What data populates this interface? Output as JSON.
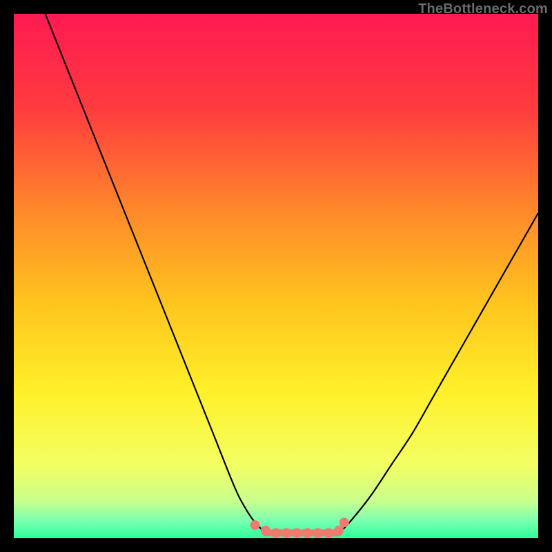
{
  "attribution": "TheBottleneck.com",
  "chart_data": {
    "type": "line",
    "title": "",
    "xlabel": "",
    "ylabel": "",
    "xlim": [
      0,
      100
    ],
    "ylim": [
      0,
      100
    ],
    "grid": false,
    "series": [
      {
        "name": "left-curve",
        "x": [
          6,
          10,
          14,
          18,
          22,
          26,
          30,
          34,
          38,
          42,
          44,
          46,
          48
        ],
        "y": [
          100,
          90,
          80,
          70,
          60,
          50,
          40,
          30,
          20,
          10,
          6,
          3,
          1
        ]
      },
      {
        "name": "right-curve",
        "x": [
          62,
          64,
          68,
          72,
          76,
          80,
          84,
          88,
          92,
          96,
          100
        ],
        "y": [
          1,
          3,
          8,
          14,
          20,
          27,
          34,
          41,
          48,
          55,
          62
        ]
      }
    ],
    "markers": {
      "name": "bottom-cluster",
      "x": [
        46,
        48,
        50,
        52,
        54,
        56,
        58,
        60,
        62,
        63
      ],
      "y": [
        2.5,
        1.5,
        1,
        1,
        1,
        1,
        1,
        1,
        1.5,
        3
      ]
    },
    "gradient_stops": [
      {
        "offset": 0.0,
        "color": "#ff1a52"
      },
      {
        "offset": 0.18,
        "color": "#ff3b3f"
      },
      {
        "offset": 0.38,
        "color": "#ff8a2a"
      },
      {
        "offset": 0.55,
        "color": "#ffc41e"
      },
      {
        "offset": 0.72,
        "color": "#fff02a"
      },
      {
        "offset": 0.86,
        "color": "#f3ff63"
      },
      {
        "offset": 0.93,
        "color": "#c8ff8d"
      },
      {
        "offset": 0.965,
        "color": "#7fffb0"
      },
      {
        "offset": 1.0,
        "color": "#2cff9a"
      }
    ]
  }
}
